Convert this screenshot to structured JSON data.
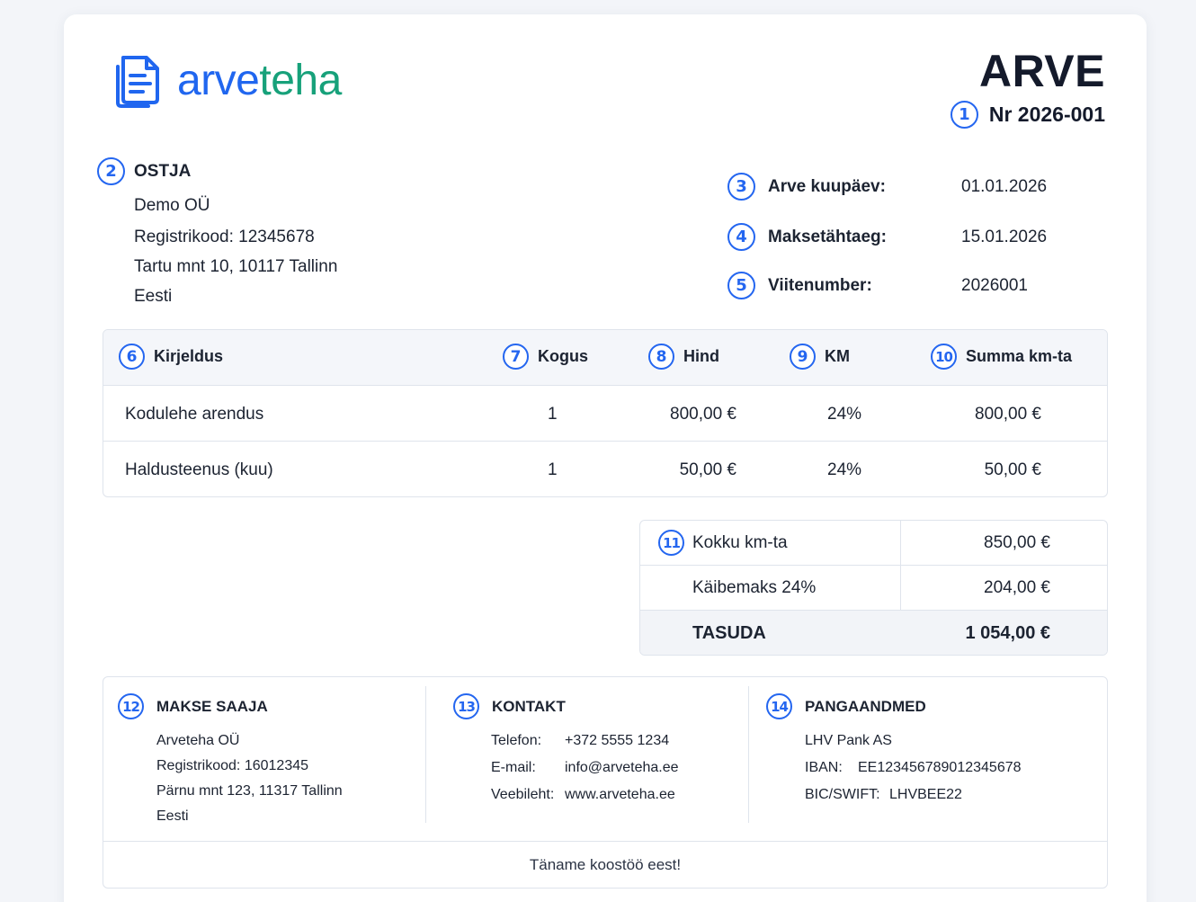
{
  "brand": {
    "name_part1": "arve",
    "name_part2": "teha",
    "color_blue": "#2066ef",
    "color_green": "#17a17a"
  },
  "accent": "#2466f0",
  "header": {
    "title": "ARVE",
    "invoice_number": "Nr 2026-001",
    "badge": "1"
  },
  "buyer": {
    "badge": "2",
    "heading": "OSTJA",
    "lines": [
      "Demo OÜ",
      "Registrikood: 12345678",
      "Tartu mnt 10, 10117 Tallinn",
      "Eesti"
    ]
  },
  "meta": [
    {
      "badge": "3",
      "label": "Arve kuupäev:",
      "value": "01.01.2026"
    },
    {
      "badge": "4",
      "label": "Maksetähtaeg:",
      "value": "15.01.2026"
    },
    {
      "badge": "5",
      "label": "Viitenumber:",
      "value": "2026001"
    }
  ],
  "items": {
    "columns": [
      {
        "badge": "6",
        "label": "Kirjeldus"
      },
      {
        "badge": "7",
        "label": "Kogus"
      },
      {
        "badge": "8",
        "label": "Hind"
      },
      {
        "badge": "9",
        "label": "KM"
      },
      {
        "badge": "10",
        "label": "Summa km-ta"
      }
    ],
    "rows": [
      {
        "description": "Kodulehe arendus",
        "qty": "1",
        "price": "800,00 €",
        "vat": "24%",
        "sum": "800,00 €"
      },
      {
        "description": "Haldusteenus (kuu)",
        "qty": "1",
        "price": "50,00 €",
        "vat": "24%",
        "sum": "50,00 €"
      }
    ]
  },
  "totals": {
    "badge": "11",
    "rows": [
      {
        "label": "Kokku km-ta",
        "value": "850,00 €"
      },
      {
        "label": "Käibemaks 24%",
        "value": "204,00 €"
      },
      {
        "label": "TASUDA",
        "value": "1 054,00 €"
      }
    ]
  },
  "footer": {
    "payee": {
      "badge": "12",
      "heading": "MAKSE SAAJA",
      "lines": [
        "Arveteha OÜ",
        "Registrikood: 16012345",
        "Pärnu mnt 123, 11317 Tallinn",
        "Eesti"
      ]
    },
    "contact": {
      "badge": "13",
      "heading": "KONTAKT",
      "rows": [
        {
          "label": "Telefon:",
          "value": "+372 5555 1234"
        },
        {
          "label": "E-mail:",
          "value": "info@arveteha.ee"
        },
        {
          "label": "Veebileht:",
          "value": "www.arveteha.ee"
        }
      ]
    },
    "bank": {
      "badge": "14",
      "heading": "PANGAANDMED",
      "bank_name": "LHV Pank AS",
      "rows": [
        {
          "label": "IBAN:",
          "value": "EE123456789012345678"
        },
        {
          "label": "BIC/SWIFT:",
          "value": "LHVBEE22"
        }
      ]
    },
    "thanks": "Täname koostöö eest!"
  }
}
